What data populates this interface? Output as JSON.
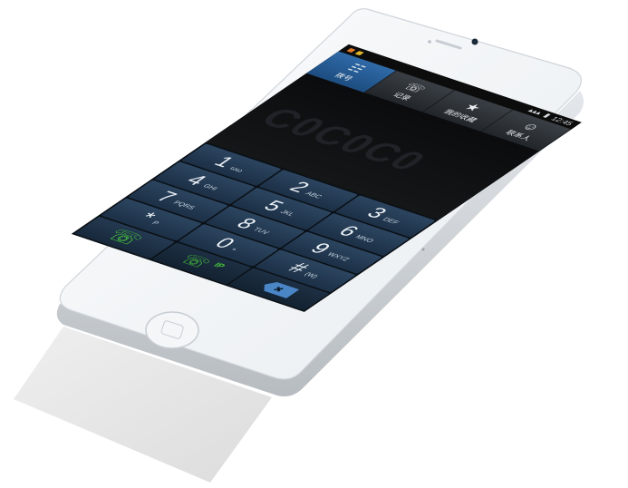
{
  "status_bar": {
    "time": "12:45",
    "battery": "▮",
    "signal": "▴▴▴"
  },
  "tabs": [
    {
      "label": "拨号",
      "icon": "dialpad-icon",
      "glyph": "☷"
    },
    {
      "label": "记录",
      "icon": "call-log-icon",
      "glyph": "☏"
    },
    {
      "label": "我的收藏",
      "icon": "star-icon",
      "glyph": "★"
    },
    {
      "label": "联系人",
      "icon": "contact-icon",
      "glyph": "☺"
    }
  ],
  "display": {
    "number": "C0C0C0"
  },
  "keys": [
    {
      "digit": "1",
      "letters": "ωω"
    },
    {
      "digit": "2",
      "letters": "ABC"
    },
    {
      "digit": "3",
      "letters": "DEF"
    },
    {
      "digit": "4",
      "letters": "GHI"
    },
    {
      "digit": "5",
      "letters": "JKL"
    },
    {
      "digit": "6",
      "letters": "MNO"
    },
    {
      "digit": "7",
      "letters": "PQRS"
    },
    {
      "digit": "8",
      "letters": "TUV"
    },
    {
      "digit": "9",
      "letters": "WXYZ"
    },
    {
      "digit": "*",
      "letters": "P"
    },
    {
      "digit": "0",
      "letters": "+"
    },
    {
      "digit": "#",
      "letters": "(W)"
    }
  ],
  "bottom_keys": {
    "call_label": "☏",
    "ip_call_label": "IP",
    "message_label": "✉",
    "delete_label": "✖"
  },
  "colors": {
    "body": "#f1f3f5",
    "bezel": "#e3e6e9",
    "key_bg": "#23384f",
    "tab_active": "#2a5f98",
    "call_green": "#46c43c",
    "message_yellow": "#f2b11a",
    "delete_blue": "#4a86c6"
  }
}
